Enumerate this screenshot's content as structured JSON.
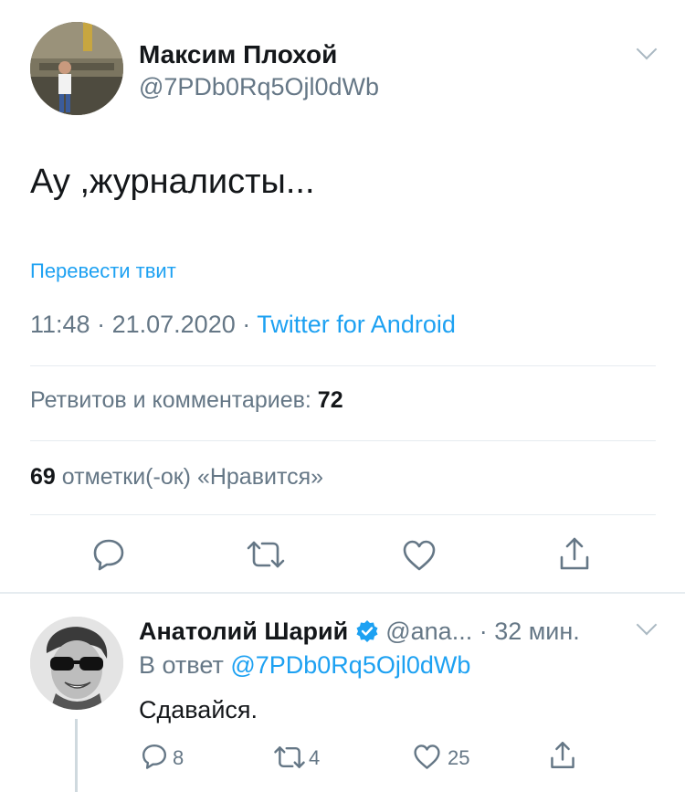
{
  "tweet": {
    "author_name": "Максим Плохой",
    "author_handle": "@7PDb0Rq5Ojl0dWb",
    "text": "Ау ,журналисты...",
    "translate_link": "Перевести твит",
    "time": "11:48",
    "date": "21.07.2020",
    "separator": "·",
    "source": "Twitter for Android",
    "retweets_label": "Ретвитов и комментариев:",
    "retweets_count": "72",
    "likes_count": "69",
    "likes_label": "отметки(-ок) «Нравится»"
  },
  "reply": {
    "author_name": "Анатолий Шарий",
    "author_handle": "@ana...",
    "time": "· 32 мин.",
    "in_reply_prefix": "В ответ",
    "in_reply_handle": "@7PDb0Rq5Ojl0dWb",
    "text": "Сдавайся.",
    "comments_count": "8",
    "retweets_count": "4",
    "likes_count": "25"
  },
  "icons": {
    "comment": "comment-icon",
    "retweet": "retweet-icon",
    "like": "heart-icon",
    "share": "share-icon",
    "verified": "verified-badge-icon",
    "menu": "chevron-down-icon"
  },
  "colors": {
    "accent": "#1da1f2",
    "secondary_text": "#657786",
    "divider": "#e6ecf0"
  }
}
